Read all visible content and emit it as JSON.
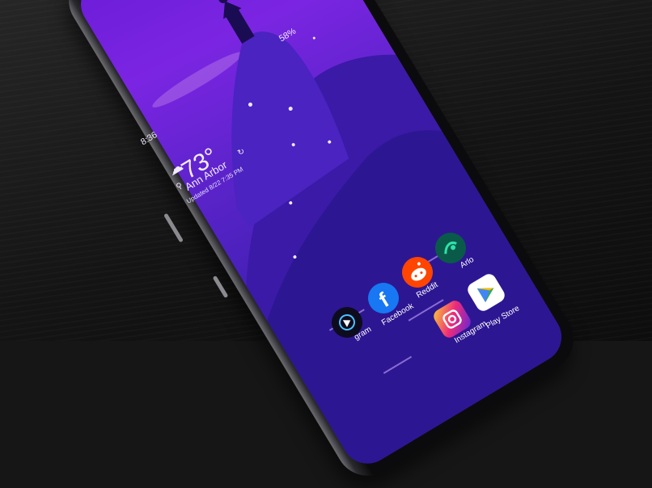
{
  "status_bar": {
    "time": "8:36",
    "battery": "58%"
  },
  "weather": {
    "temperature": "73°",
    "location": "Ann Arbor",
    "updated": "Updated 8/22 7:35 PM"
  },
  "apps": [
    {
      "label": "Arlo",
      "icon": "arlo-icon"
    },
    {
      "label": "Reddit",
      "icon": "reddit-icon"
    },
    {
      "label": "Play Store",
      "icon": "play-store-icon"
    },
    {
      "label": "Facebook",
      "icon": "facebook-icon"
    },
    {
      "label": "Instagram",
      "icon": "instagram-icon"
    },
    {
      "label": "gram",
      "icon": "dock-app-icon"
    }
  ],
  "colors": {
    "wallpaper_top": "#7b25e2",
    "wallpaper_bottom": "#3d1fb0",
    "table": "#161616"
  }
}
